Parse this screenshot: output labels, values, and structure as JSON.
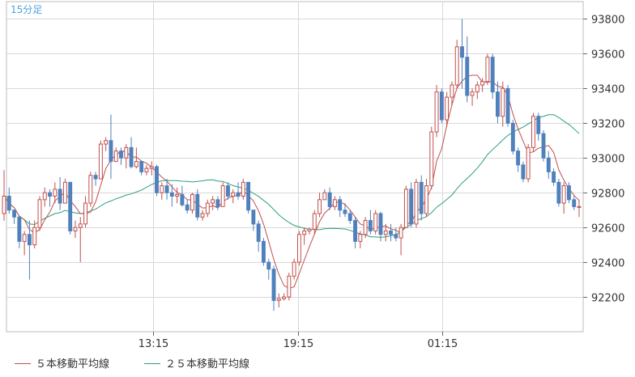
{
  "chart_data": {
    "type": "candlestick",
    "title": "",
    "timeframe_label": "15分足",
    "x_ticks": [
      "13:15",
      "19:15",
      "01:15"
    ],
    "ylim": [
      92000,
      93900
    ],
    "y_ticks": [
      92200,
      92400,
      92600,
      92800,
      93000,
      93200,
      93400,
      93600,
      93800
    ],
    "colors": {
      "up_candle": "#c0504d",
      "down_candle": "#4f81bd",
      "ma5": "#c0504d",
      "ma25": "#2e9e7e",
      "grid": "#d8d8d8",
      "label": "#333333",
      "timeframe": "#4aa3df"
    },
    "candles": [
      [
        92680,
        92930,
        92640,
        92780
      ],
      [
        92780,
        92830,
        92680,
        92700
      ],
      [
        92700,
        92700,
        92620,
        92660
      ],
      [
        92660,
        92660,
        92480,
        92520
      ],
      [
        92520,
        92580,
        92440,
        92560
      ],
      [
        92560,
        92640,
        92300,
        92500
      ],
      [
        92500,
        92640,
        92480,
        92600
      ],
      [
        92600,
        92780,
        92580,
        92760
      ],
      [
        92760,
        92830,
        92720,
        92800
      ],
      [
        92800,
        92820,
        92720,
        92780
      ],
      [
        92780,
        92860,
        92740,
        92820
      ],
      [
        92820,
        92890,
        92700,
        92740
      ],
      [
        92740,
        92880,
        92740,
        92860
      ],
      [
        92860,
        92860,
        92560,
        92580
      ],
      [
        92580,
        92640,
        92540,
        92600
      ],
      [
        92600,
        92660,
        92400,
        92620
      ],
      [
        92620,
        92780,
        92600,
        92740
      ],
      [
        92740,
        92920,
        92720,
        92900
      ],
      [
        92900,
        92920,
        92840,
        92880
      ],
      [
        92880,
        93100,
        92880,
        93080
      ],
      [
        93080,
        93120,
        93040,
        93100
      ],
      [
        93100,
        93250,
        92880,
        92980
      ],
      [
        92980,
        93060,
        92980,
        93040
      ],
      [
        93040,
        93060,
        92960,
        93000
      ],
      [
        93000,
        93080,
        92940,
        93060
      ],
      [
        93060,
        93120,
        92940,
        92950
      ],
      [
        92950,
        93060,
        92940,
        92980
      ],
      [
        92980,
        92980,
        92900,
        92920
      ],
      [
        92920,
        92960,
        92900,
        92940
      ],
      [
        92940,
        92980,
        92900,
        92950
      ],
      [
        92950,
        92960,
        92780,
        92800
      ],
      [
        92800,
        92860,
        92760,
        92840
      ],
      [
        92840,
        92880,
        92760,
        92800
      ],
      [
        92800,
        92850,
        92720,
        92780
      ],
      [
        92780,
        92830,
        92740,
        92790
      ],
      [
        92790,
        92840,
        92720,
        92730
      ],
      [
        92730,
        92760,
        92680,
        92700
      ],
      [
        92700,
        92800,
        92680,
        92790
      ],
      [
        92790,
        92820,
        92640,
        92660
      ],
      [
        92660,
        92700,
        92640,
        92680
      ],
      [
        92680,
        92760,
        92660,
        92740
      ],
      [
        92740,
        92780,
        92700,
        92760
      ],
      [
        92760,
        92780,
        92700,
        92720
      ],
      [
        92720,
        92860,
        92720,
        92840
      ],
      [
        92840,
        92860,
        92760,
        92780
      ],
      [
        92780,
        92820,
        92740,
        92800
      ],
      [
        92800,
        92860,
        92760,
        92780
      ],
      [
        92780,
        92880,
        92760,
        92860
      ],
      [
        92860,
        92860,
        92680,
        92700
      ],
      [
        92700,
        92700,
        92580,
        92620
      ],
      [
        92620,
        92640,
        92460,
        92520
      ],
      [
        92520,
        92540,
        92380,
        92400
      ],
      [
        92400,
        92420,
        92300,
        92360
      ],
      [
        92360,
        92380,
        92120,
        92180
      ],
      [
        92180,
        92220,
        92140,
        92190
      ],
      [
        92190,
        92220,
        92180,
        92200
      ],
      [
        92200,
        92340,
        92180,
        92320
      ],
      [
        92320,
        92420,
        92300,
        92400
      ],
      [
        92400,
        92580,
        92380,
        92560
      ],
      [
        92560,
        92600,
        92500,
        92580
      ],
      [
        92580,
        92600,
        92560,
        92590
      ],
      [
        92590,
        92700,
        92560,
        92680
      ],
      [
        92680,
        92800,
        92660,
        92760
      ],
      [
        92760,
        92820,
        92760,
        92800
      ],
      [
        92800,
        92830,
        92700,
        92720
      ],
      [
        92720,
        92780,
        92700,
        92760
      ],
      [
        92760,
        92780,
        92660,
        92700
      ],
      [
        92700,
        92740,
        92660,
        92680
      ],
      [
        92680,
        92700,
        92620,
        92640
      ],
      [
        92640,
        92660,
        92480,
        92520
      ],
      [
        92520,
        92580,
        92480,
        92560
      ],
      [
        92560,
        92660,
        92540,
        92640
      ],
      [
        92640,
        92700,
        92560,
        92580
      ],
      [
        92580,
        92700,
        92560,
        92680
      ],
      [
        92680,
        92690,
        92520,
        92560
      ],
      [
        92560,
        92620,
        92520,
        92580
      ],
      [
        92580,
        92620,
        92520,
        92560
      ],
      [
        92560,
        92600,
        92520,
        92540
      ],
      [
        92540,
        92620,
        92440,
        92600
      ],
      [
        92600,
        92840,
        92600,
        92820
      ],
      [
        92820,
        92860,
        92600,
        92620
      ],
      [
        92620,
        92880,
        92600,
        92860
      ],
      [
        92860,
        92900,
        92640,
        92680
      ],
      [
        92680,
        92880,
        92660,
        92840
      ],
      [
        92840,
        93180,
        92820,
        93150
      ],
      [
        93150,
        93420,
        93120,
        93380
      ],
      [
        93380,
        93400,
        93200,
        93220
      ],
      [
        93220,
        93380,
        93180,
        93350
      ],
      [
        93350,
        93440,
        93300,
        93420
      ],
      [
        93420,
        93680,
        93400,
        93640
      ],
      [
        93640,
        93800,
        93400,
        93580
      ],
      [
        93580,
        93700,
        93320,
        93360
      ],
      [
        93360,
        93400,
        93300,
        93380
      ],
      [
        93380,
        93440,
        93340,
        93420
      ],
      [
        93420,
        93460,
        93380,
        93440
      ],
      [
        93440,
        93600,
        93420,
        93580
      ],
      [
        93580,
        93600,
        93340,
        93380
      ],
      [
        93380,
        93440,
        93200,
        93240
      ],
      [
        93240,
        93440,
        93180,
        93400
      ],
      [
        93400,
        93420,
        93180,
        93200
      ],
      [
        93200,
        93220,
        93020,
        93040
      ],
      [
        93040,
        93060,
        92920,
        92960
      ],
      [
        92960,
        92980,
        92860,
        92880
      ],
      [
        92880,
        93080,
        92860,
        93060
      ],
      [
        93060,
        93260,
        93040,
        93240
      ],
      [
        93240,
        93260,
        93100,
        93140
      ],
      [
        93140,
        93160,
        92980,
        93000
      ],
      [
        93000,
        93040,
        92880,
        92920
      ],
      [
        92920,
        92940,
        92840,
        92860
      ],
      [
        92860,
        92880,
        92720,
        92740
      ],
      [
        92740,
        92860,
        92680,
        92840
      ],
      [
        92840,
        92860,
        92740,
        92760
      ],
      [
        92760,
        92780,
        92700,
        92720
      ],
      [
        92720,
        92760,
        92660,
        92720
      ]
    ],
    "legend": [
      {
        "name": "５本移動平均線",
        "color_key": "ma5"
      },
      {
        "name": "２５本移動平均線",
        "color_key": "ma25"
      }
    ]
  }
}
